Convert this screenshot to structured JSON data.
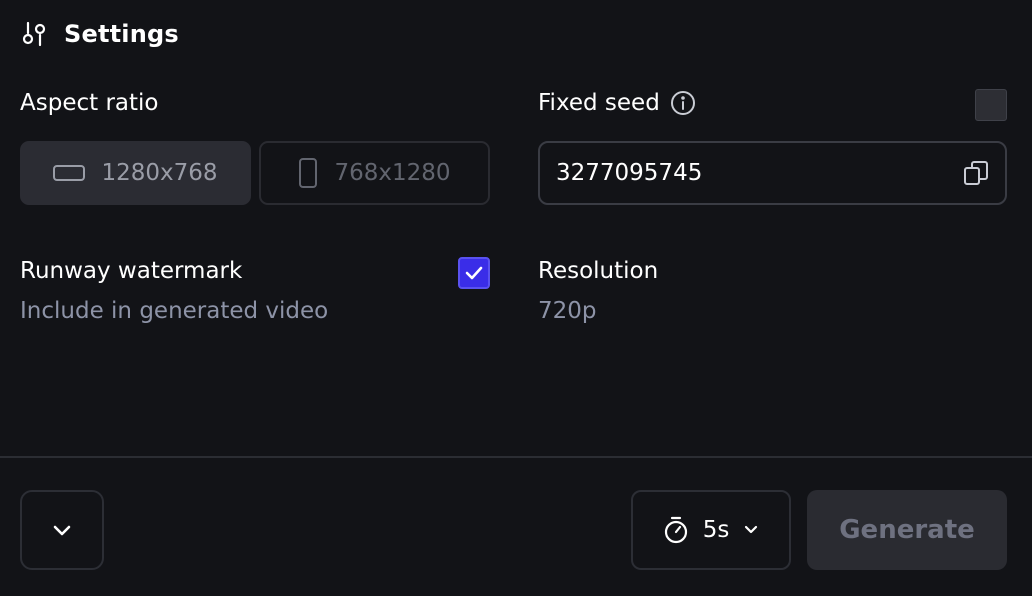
{
  "header": {
    "title": "Settings",
    "icon": "sliders-icon"
  },
  "aspect_ratio": {
    "label": "Aspect ratio",
    "options": [
      {
        "label": "1280x768",
        "icon": "landscape-icon",
        "selected": true
      },
      {
        "label": "768x1280",
        "icon": "portrait-icon",
        "selected": false
      }
    ]
  },
  "fixed_seed": {
    "label": "Fixed seed",
    "enabled": false,
    "value": "3277095745",
    "info_icon": "info-icon",
    "copy_icon": "copy-icon"
  },
  "watermark": {
    "label": "Runway watermark",
    "description": "Include in generated video",
    "checked": true
  },
  "resolution": {
    "label": "Resolution",
    "value": "720p"
  },
  "footer": {
    "expand_icon": "chevron-down-icon",
    "duration": {
      "value": "5s",
      "icon": "timer-icon"
    },
    "generate_label": "Generate"
  },
  "colors": {
    "background": "#121317",
    "accent": "#3a2de8",
    "muted_text": "#8d93a7"
  }
}
